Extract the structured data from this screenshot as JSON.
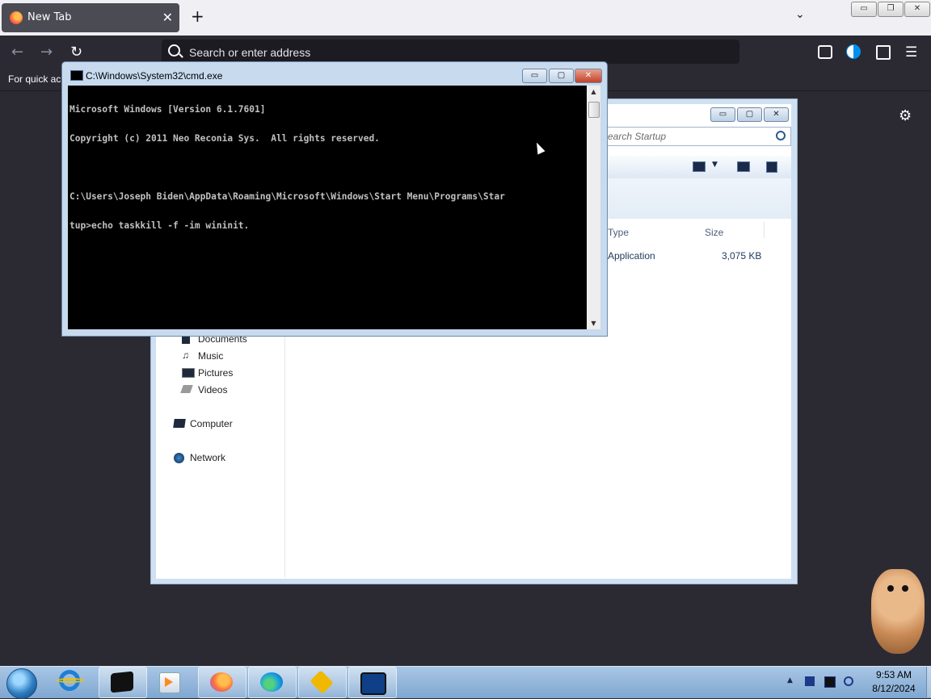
{
  "browser": {
    "tab_title": "New Tab",
    "tab_close": "✕",
    "new_tab": "+",
    "list_tabs": "⌄",
    "address_placeholder": "Search or enter address",
    "bookmarks_text": "For quick ac",
    "back": "←",
    "forward": "→",
    "reload": "↻",
    "menu": "☰",
    "settings": "⚙",
    "window_min": "▭",
    "window_restore": "❐",
    "window_close": "✕"
  },
  "explorer": {
    "search_placeholder": "earch Startup",
    "columns": {
      "type": "Type",
      "size": "Size"
    },
    "file": {
      "type": "Application",
      "size": "3,075 KB"
    },
    "nav": {
      "documents": "Documents",
      "music": "Music",
      "pictures": "Pictures",
      "videos": "Videos",
      "computer": "Computer",
      "network": "Network"
    },
    "btn_min": "▭",
    "btn_max": "▢",
    "btn_close": "✕"
  },
  "cmd": {
    "title": "C:\\Windows\\System32\\cmd.exe",
    "lines": [
      "Microsoft Windows [Version 6.1.7601]",
      "Copyright (c) 2011 Neo Reconia Sys.  All rights reserved.",
      "",
      "C:\\Users\\Joseph Biden\\AppData\\Roaming\\Microsoft\\Windows\\Start Menu\\Programs\\Star",
      "tup>echo taskkill -f -im wininit."
    ],
    "btn_min": "▭",
    "btn_max": "▢",
    "btn_close": "✕",
    "scroll_up": "▲",
    "scroll_down": "▼"
  },
  "taskbar": {
    "time": "9:53 AM",
    "date": "8/12/2024",
    "tray_arrow": "▲"
  }
}
